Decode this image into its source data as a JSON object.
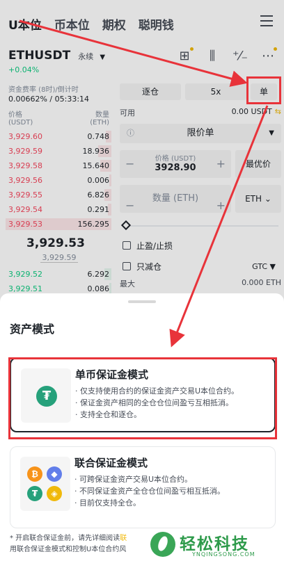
{
  "top_tabs": [
    "U本位",
    "币本位",
    "期权",
    "聪明钱"
  ],
  "pair": {
    "symbol": "ETHUSDT",
    "type": "永续",
    "change": "+0.04%"
  },
  "funding": {
    "label": "资金费率 (8时)/倒计时",
    "value": "0.00662% / 05:33:14"
  },
  "orderbook": {
    "price_header": "价格",
    "price_unit": "(USDT)",
    "qty_header": "数量",
    "qty_unit": "(ETH)",
    "asks": [
      {
        "price": "3,929.60",
        "qty": "0.748",
        "depth": 0.05
      },
      {
        "price": "3,929.59",
        "qty": "18.936",
        "depth": 0.12
      },
      {
        "price": "3,929.58",
        "qty": "15.640",
        "depth": 0.1
      },
      {
        "price": "3,929.56",
        "qty": "0.006",
        "depth": 0.02
      },
      {
        "price": "3,929.55",
        "qty": "6.826",
        "depth": 0.06
      },
      {
        "price": "3,929.54",
        "qty": "0.291",
        "depth": 0.03
      },
      {
        "price": "3,929.53",
        "qty": "156.295",
        "depth": 0.95
      }
    ],
    "last_price": "3,929.53",
    "mark_price": "3,929.59",
    "bids": [
      {
        "price": "3,929.52",
        "qty": "6.292",
        "depth": 0.06
      },
      {
        "price": "3,929.51",
        "qty": "0.086",
        "depth": 0.02
      }
    ]
  },
  "order_panel": {
    "margin_mode": "逐仓",
    "leverage": "5x",
    "asset_mode": "单",
    "available_label": "可用",
    "available_value": "0.00 USDT",
    "swap_icon": "⇆",
    "order_type": "限价单",
    "price_label": "价格 (USDT)",
    "price_value": "3928.90",
    "best_price": "最优价",
    "qty_placeholder": "数量 (ETH)",
    "qty_unit": "ETH",
    "tp_sl": "止盈/止损",
    "reduce_only": "只减仓",
    "tif": "GTC",
    "max_label": "最大",
    "max_value": "0.000 ETH"
  },
  "sheet": {
    "title": "资产模式",
    "single": {
      "title": "单币保证金模式",
      "lines": [
        "仅支持使用合约的保证金资产交易U本位合约。",
        "保证金资产相同的全仓仓位间盈亏互相抵消。",
        "支持全仓和逐仓。"
      ],
      "icon_glyph": "₮"
    },
    "multi": {
      "title": "联合保证金模式",
      "lines": [
        "可跨保证金资产交易U本位合约。",
        "不同保证金资产全仓仓位间盈亏相互抵消。",
        "目前仅支持全仓。"
      ],
      "coins": [
        {
          "glyph": "₿",
          "color": "#f7931a"
        },
        {
          "glyph": "◆",
          "color": "#627eea"
        },
        {
          "glyph": "₮",
          "color": "#26a17b"
        },
        {
          "glyph": "◈",
          "color": "#f0b90b"
        }
      ]
    },
    "footnote_pre": "* 开启联合保证金前，请先详细阅读",
    "footnote_link": "联",
    "footnote_line2": "用联合保证金模式和控制U本位合约风"
  },
  "watermark": {
    "text": "轻松科技",
    "sub": "YNQINGSONG.COM"
  },
  "colors": {
    "annotation_red": "#e8333a",
    "buy_green": "#0ecb81",
    "sell_red": "#f6465d",
    "brand_yellow": "#f0b90b"
  }
}
